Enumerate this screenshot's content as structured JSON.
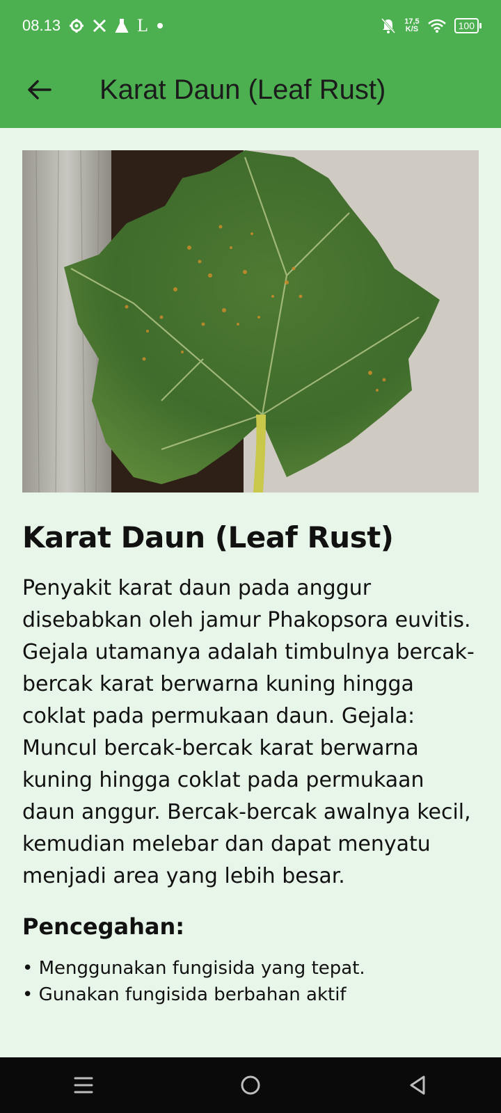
{
  "status_bar": {
    "time": "08.13",
    "notification_letter": "L",
    "net_speed_value": "17,5",
    "net_speed_unit": "K/S",
    "battery": "100"
  },
  "app_bar": {
    "title": "Karat Daun (Leaf Rust)"
  },
  "hero_image": {
    "subject": "grape-leaf-with-rust-spots"
  },
  "article": {
    "heading": "Karat Daun (Leaf Rust)",
    "description": "Penyakit karat daun pada anggur disebabkan oleh jamur Phakopsora euvitis. Gejala utamanya adalah timbulnya bercak-bercak karat berwarna kuning hingga coklat pada permukaan daun. Gejala: Muncul bercak-bercak karat berwarna kuning hingga coklat pada permukaan daun anggur. Bercak-bercak awalnya kecil, kemudian melebar dan dapat menyatu menjadi area yang lebih besar.",
    "prevention_heading": "Pencegahan:",
    "prevention_items": [
      "Menggunakan fungisida yang tepat.",
      "Gunakan fungisida berbahan aktif"
    ]
  },
  "colors": {
    "app_bar": "#4caf50",
    "background": "#e8f5e9",
    "nav_bar": "#0a0a0a"
  }
}
